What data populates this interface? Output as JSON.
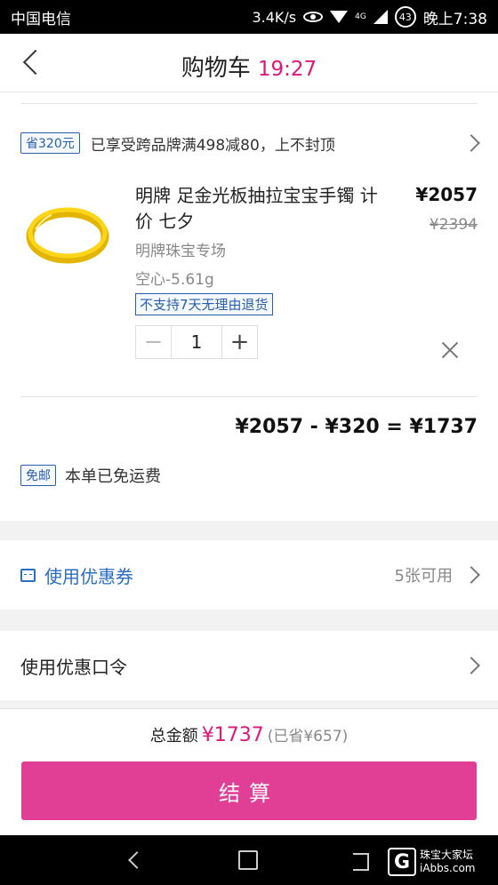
{
  "status_bar": {
    "carrier": "中国电信",
    "speed": "3.4K/s",
    "network": "4G",
    "battery": "43",
    "time": "晚上7:38"
  },
  "header": {
    "title": "购物车",
    "countdown": "19:27"
  },
  "promo": {
    "badge": "省320元",
    "text": "已享受跨品牌满498减80，上不封顶"
  },
  "product": {
    "title": "明牌 足金光板抽拉宝宝手镯 计价 七夕",
    "price": "¥2057",
    "original_price": "¥2394",
    "shop": "明牌珠宝专场",
    "spec": "空心-5.61g",
    "return_policy": "不支持7天无理由退货",
    "quantity": "1",
    "minus_label": "−",
    "plus_label": "+"
  },
  "calculation": "¥2057 - ¥320 = ¥1737",
  "shipping": {
    "badge": "免邮",
    "text": "本单已免运费"
  },
  "coupon": {
    "label": "使用优惠券",
    "available": "5张可用"
  },
  "promo_code": {
    "label": "使用优惠口令"
  },
  "footer": {
    "total_label": "总金额",
    "total_amount": "¥1737",
    "saved": "(已省¥657)",
    "checkout_label": "结算"
  },
  "watermark": {
    "logo": "G",
    "line1": "珠宝大家坛",
    "line2": "iAbbs.com"
  },
  "colors": {
    "accent_pink": "#e0177a",
    "checkout_button": "#e13f96",
    "link_blue": "#2a6dc4",
    "product_gold": "#f2c200"
  }
}
